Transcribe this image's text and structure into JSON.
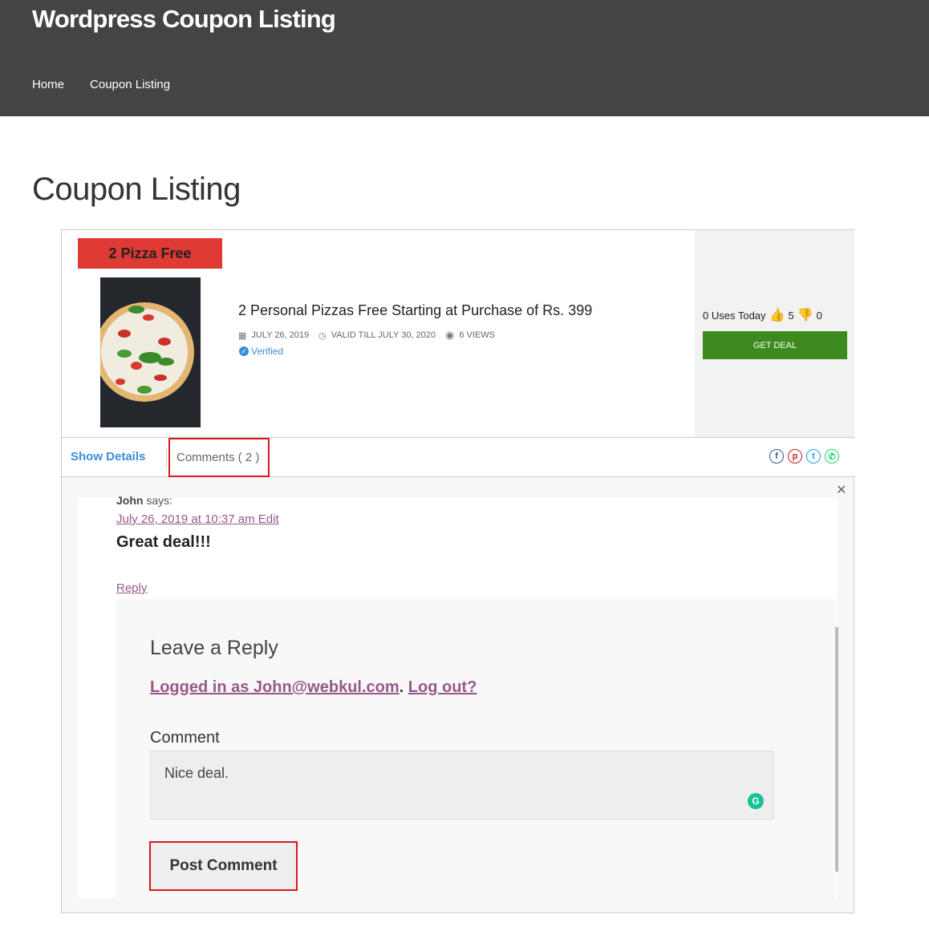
{
  "site": {
    "title": "Wordpress Coupon Listing"
  },
  "nav": {
    "items": [
      {
        "label": "Home"
      },
      {
        "label": "Coupon Listing"
      }
    ]
  },
  "page": {
    "title": "Coupon Listing"
  },
  "coupon": {
    "badge": "2 Pizza Free",
    "title": "2 Personal Pizzas Free Starting at Purchase of Rs. 399",
    "date": "JULY 26, 2019",
    "valid": "VALID TILL JULY 30, 2020",
    "views": "6 VIEWS",
    "verified": "Verified",
    "uses_today": "0 Uses Today",
    "likes": "5",
    "dislikes": "0",
    "get_deal": "GET DEAL",
    "icons": {
      "date": "calendar-icon",
      "valid": "clock-icon",
      "views": "eye-icon",
      "like": "thumbs-up-icon",
      "dislike": "thumbs-down-icon"
    }
  },
  "tabs": {
    "details": "Show Details",
    "comments": "Comments ( 2 )"
  },
  "share": [
    {
      "icon": "facebook-icon",
      "color": "#3b5998"
    },
    {
      "icon": "pinterest-icon",
      "color": "#cb2027"
    },
    {
      "icon": "twitter-icon",
      "color": "#1da1f2"
    },
    {
      "icon": "whatsapp-icon",
      "color": "#25d366"
    }
  ],
  "comment": {
    "author": "John",
    "says": "says:",
    "date": "July 26, 2019 at 10:37 am",
    "edit": "Edit",
    "text": "Great deal!!!",
    "reply": "Reply"
  },
  "reply_form": {
    "title": "Leave a Reply",
    "logged_in": "Logged in as John@webkul.com",
    "logout": "Log out?",
    "comment_label": "Comment",
    "comment_value": "Nice deal.",
    "submit": "Post Comment"
  },
  "colors": {
    "header_bg": "#444444",
    "badge": "#e03a34",
    "get_deal": "#3d8b1e",
    "link_purple": "#96588a",
    "link_blue": "#3b8ed9",
    "highlight": "#d9181e"
  }
}
